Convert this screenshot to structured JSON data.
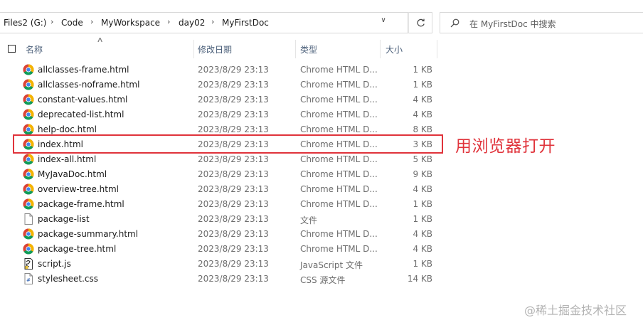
{
  "address_bar": {
    "segments": [
      "Files2 (G:)",
      "Code",
      "MyWorkspace",
      "day02",
      "MyFirstDoc"
    ]
  },
  "search": {
    "placeholder": "在 MyFirstDoc 中搜索"
  },
  "columns": {
    "name": "名称",
    "date": "修改日期",
    "type": "类型",
    "size": "大小"
  },
  "files": [
    {
      "name": "allclasses-frame.html",
      "date": "2023/8/29 23:13",
      "type": "Chrome HTML D...",
      "size": "1 KB",
      "icon": "chrome-icon"
    },
    {
      "name": "allclasses-noframe.html",
      "date": "2023/8/29 23:13",
      "type": "Chrome HTML D...",
      "size": "1 KB",
      "icon": "chrome-icon"
    },
    {
      "name": "constant-values.html",
      "date": "2023/8/29 23:13",
      "type": "Chrome HTML D...",
      "size": "4 KB",
      "icon": "chrome-icon"
    },
    {
      "name": "deprecated-list.html",
      "date": "2023/8/29 23:13",
      "type": "Chrome HTML D...",
      "size": "4 KB",
      "icon": "chrome-icon"
    },
    {
      "name": "help-doc.html",
      "date": "2023/8/29 23:13",
      "type": "Chrome HTML D...",
      "size": "8 KB",
      "icon": "chrome-icon"
    },
    {
      "name": "index.html",
      "date": "2023/8/29 23:13",
      "type": "Chrome HTML D...",
      "size": "3 KB",
      "icon": "chrome-icon"
    },
    {
      "name": "index-all.html",
      "date": "2023/8/29 23:13",
      "type": "Chrome HTML D...",
      "size": "5 KB",
      "icon": "chrome-icon"
    },
    {
      "name": "MyJavaDoc.html",
      "date": "2023/8/29 23:13",
      "type": "Chrome HTML D...",
      "size": "9 KB",
      "icon": "chrome-icon"
    },
    {
      "name": "overview-tree.html",
      "date": "2023/8/29 23:13",
      "type": "Chrome HTML D...",
      "size": "4 KB",
      "icon": "chrome-icon"
    },
    {
      "name": "package-frame.html",
      "date": "2023/8/29 23:13",
      "type": "Chrome HTML D...",
      "size": "1 KB",
      "icon": "chrome-icon"
    },
    {
      "name": "package-list",
      "date": "2023/8/29 23:13",
      "type": "文件",
      "size": "1 KB",
      "icon": "file-icon"
    },
    {
      "name": "package-summary.html",
      "date": "2023/8/29 23:13",
      "type": "Chrome HTML D...",
      "size": "4 KB",
      "icon": "chrome-icon"
    },
    {
      "name": "package-tree.html",
      "date": "2023/8/29 23:13",
      "type": "Chrome HTML D...",
      "size": "4 KB",
      "icon": "chrome-icon"
    },
    {
      "name": "script.js",
      "date": "2023/8/29 23:13",
      "type": "JavaScript 文件",
      "size": "1 KB",
      "icon": "script-file-icon"
    },
    {
      "name": "stylesheet.css",
      "date": "2023/8/29 23:13",
      "type": "CSS 源文件",
      "size": "14 KB",
      "icon": "css-file-icon"
    }
  ],
  "annotation": {
    "text": "用浏览器打开",
    "color": "#e0333b"
  },
  "watermark": "@稀土掘金技术社区"
}
